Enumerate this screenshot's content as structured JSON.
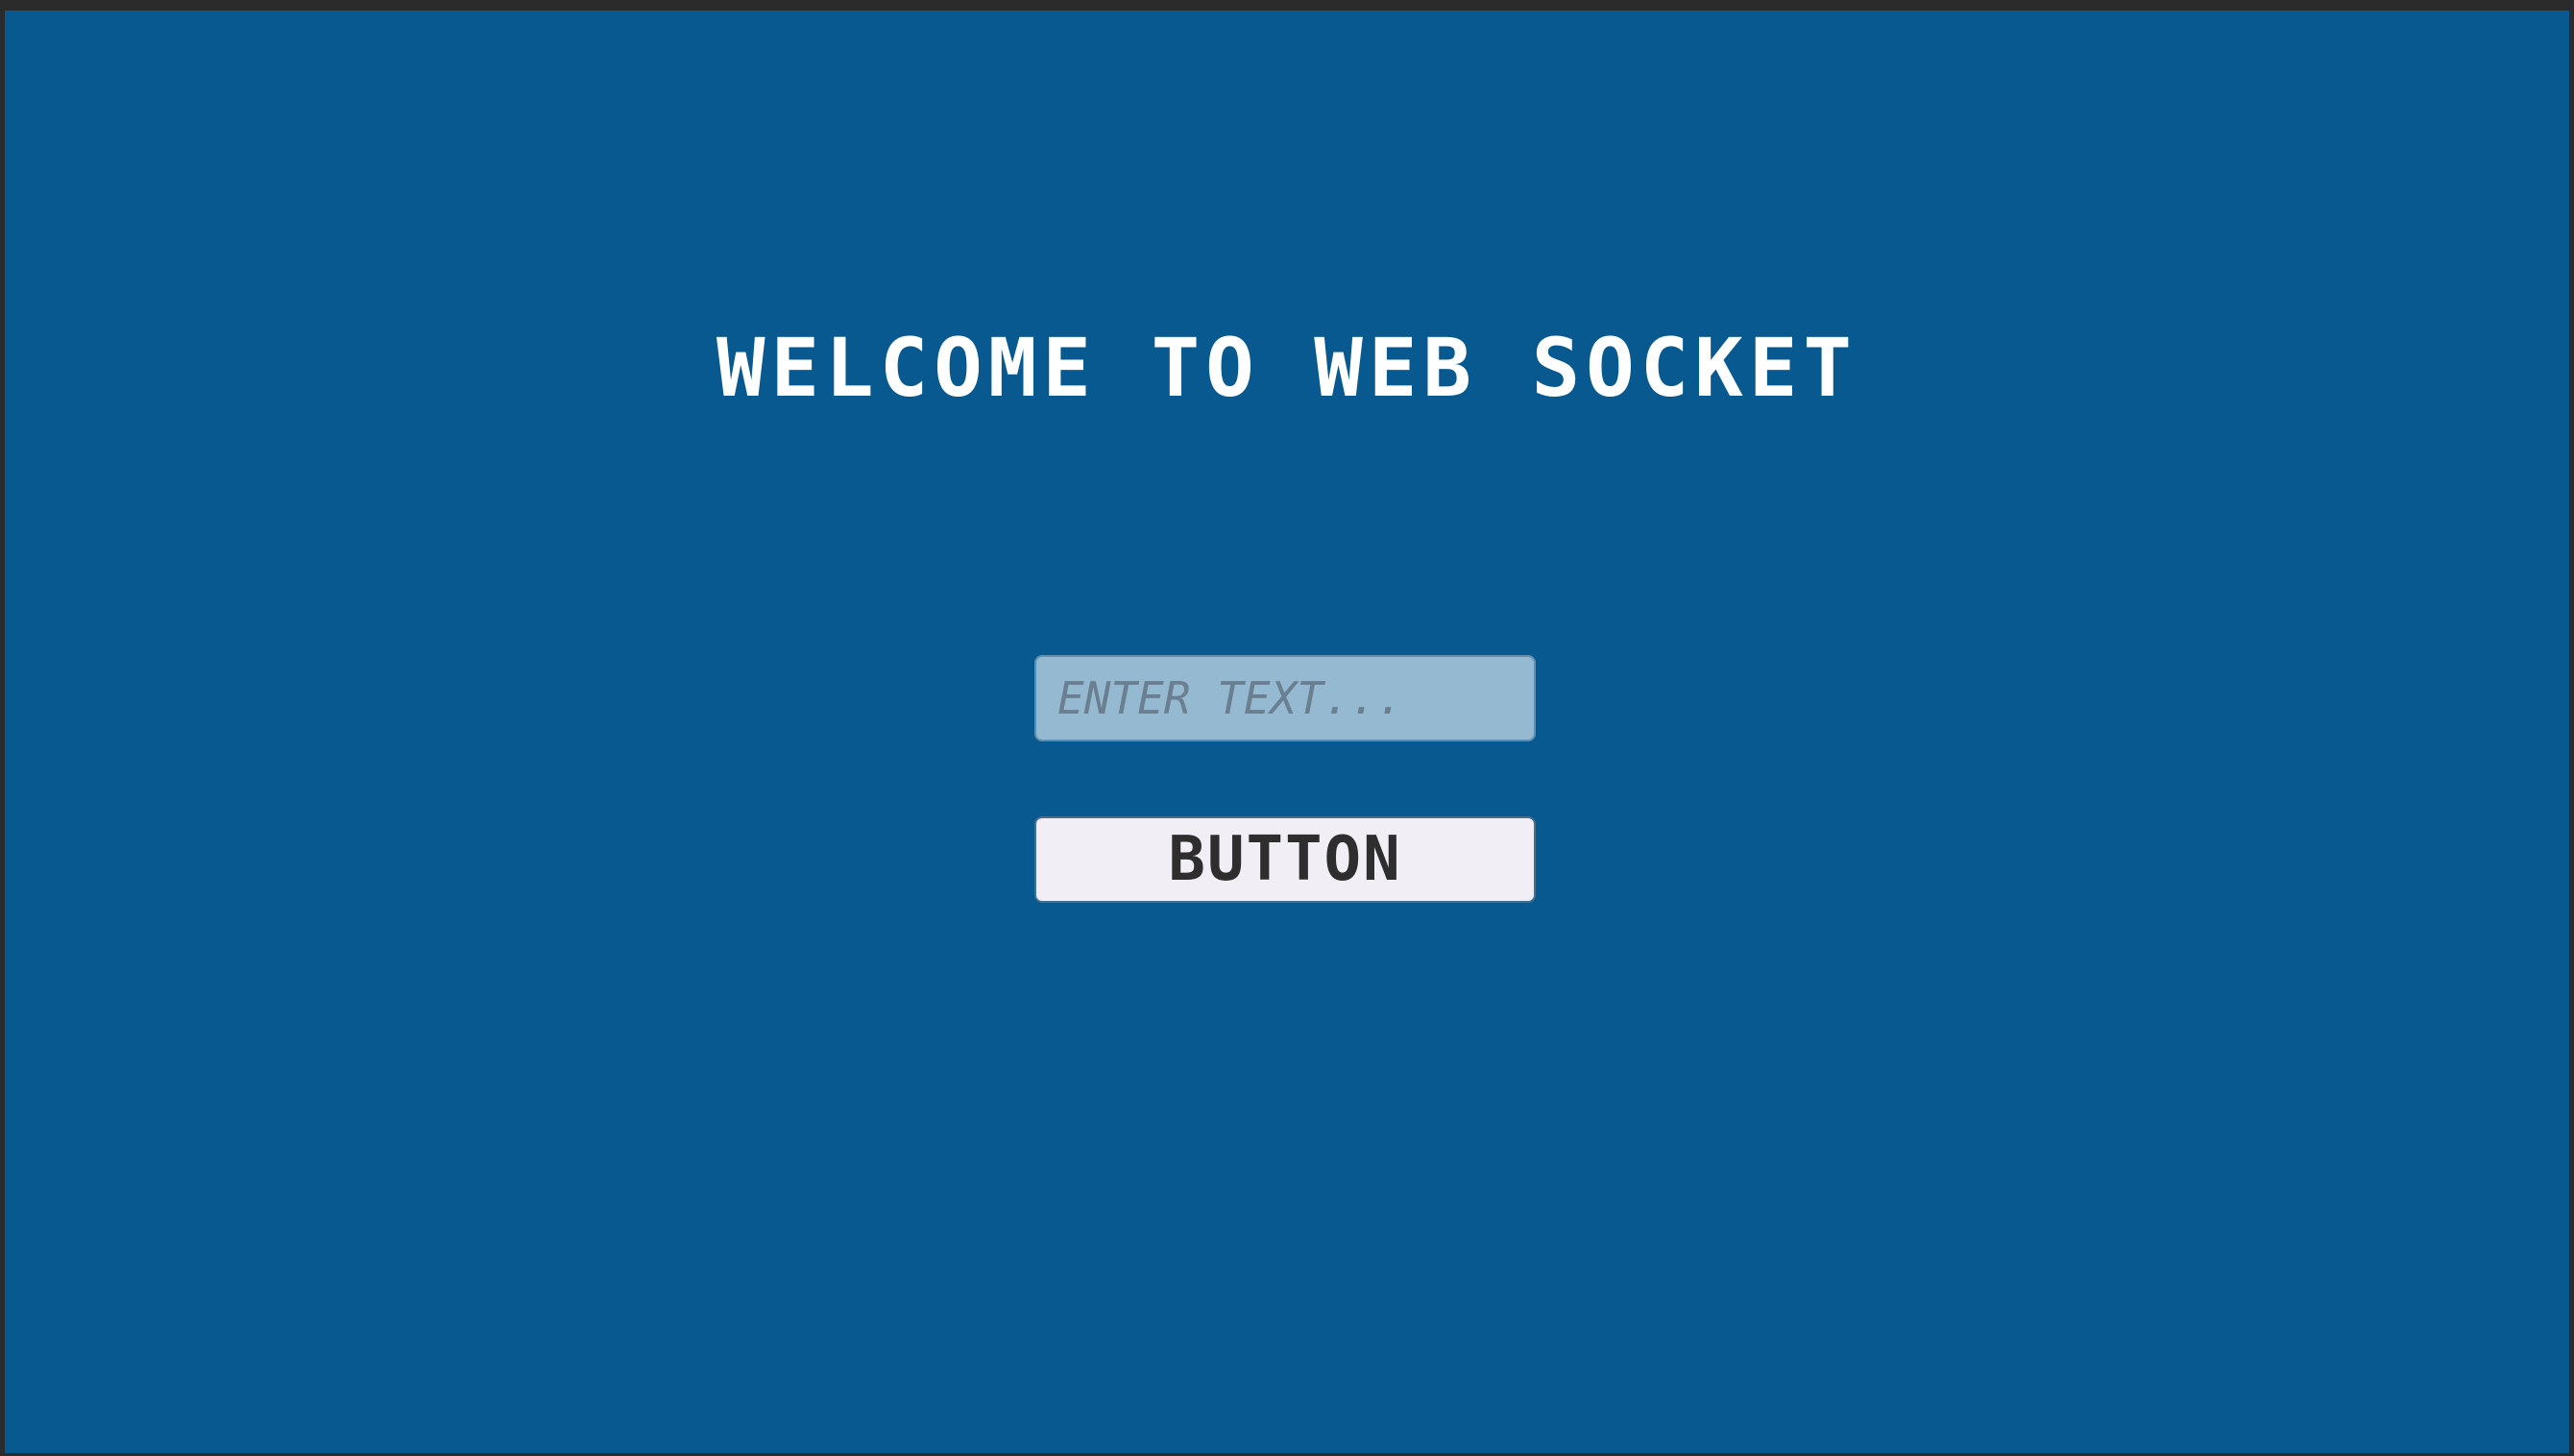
{
  "screen": {
    "title": "WELCOME TO WEB SOCKET",
    "input": {
      "placeholder": "ENTER TEXT...",
      "value": ""
    },
    "button": {
      "label": "BUTTON"
    }
  },
  "colors": {
    "background": "#07598f",
    "frame": "#2b2b2b",
    "title_text": "#ffffff",
    "input_fill": "#95b9d0",
    "button_fill": "#f1eff5"
  }
}
